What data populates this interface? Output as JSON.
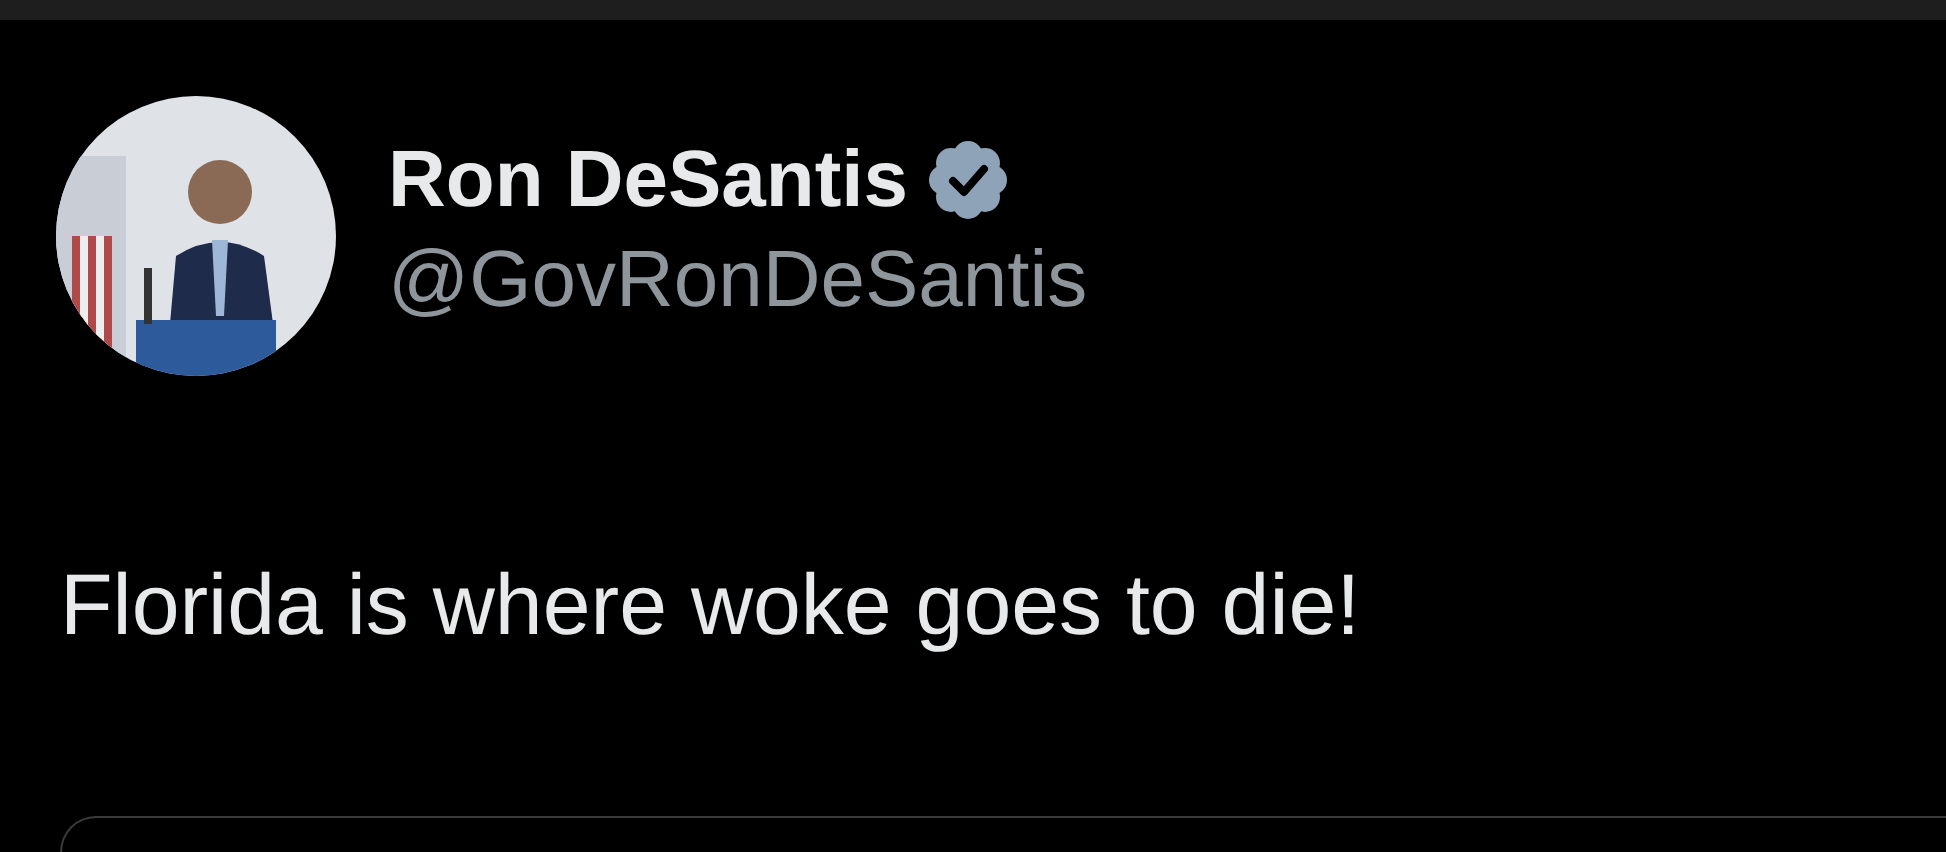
{
  "author": {
    "name": "Ron DeSantis",
    "handle": "@GovRonDeSantis",
    "verified": true
  },
  "text": "Florida is where woke goes to die!"
}
